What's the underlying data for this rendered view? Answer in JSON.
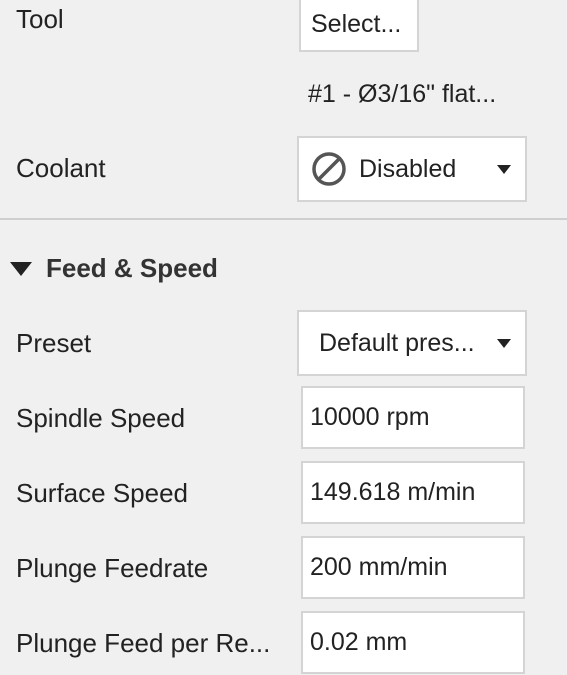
{
  "tool": {
    "label": "Tool",
    "select_label": "Select...",
    "tool_name": "#1 - Ø3/16\" flat..."
  },
  "coolant": {
    "label": "Coolant",
    "value": "Disabled",
    "icon": "disabled-circle-icon"
  },
  "feed_speed": {
    "section_title": "Feed & Speed",
    "preset": {
      "label": "Preset",
      "value": "Default pres..."
    },
    "spindle_speed": {
      "label": "Spindle Speed",
      "value": "10000 rpm"
    },
    "surface_speed": {
      "label": "Surface Speed",
      "value": "149.618 m/min"
    },
    "plunge_feedrate": {
      "label": "Plunge Feedrate",
      "value": "200 mm/min"
    },
    "plunge_feed_per_rev": {
      "label": "Plunge Feed per Re...",
      "value": "0.02 mm"
    }
  }
}
